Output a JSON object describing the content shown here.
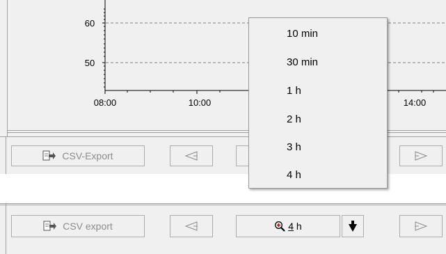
{
  "chart": {
    "y_ticks": [
      "60",
      "50"
    ],
    "x_ticks": [
      "08:00",
      "10:00",
      "14:00"
    ]
  },
  "toolbar_top": {
    "csv_label": "CSV-Export",
    "prev_icon": "triangle-left-outline-icon",
    "next_icon": "triangle-right-outline-icon"
  },
  "time_menu": {
    "items": [
      "10 min",
      "30 min",
      "1 h",
      "2 h",
      "3 h",
      "4 h"
    ]
  },
  "toolbar_bottom": {
    "csv_label": "CSV export",
    "zoom_prefix": "",
    "zoom_underlined": "4",
    "zoom_suffix": " h",
    "zoom_icon": "zoom-in-magnifier-icon",
    "dropdown_icon": "arrow-down-icon"
  },
  "colors": {
    "panel_bg": "#f0f0f0",
    "disabled_text": "#8c8c8c",
    "grid": "#7f7f7f",
    "zoom_icon_red": "#c00000"
  }
}
